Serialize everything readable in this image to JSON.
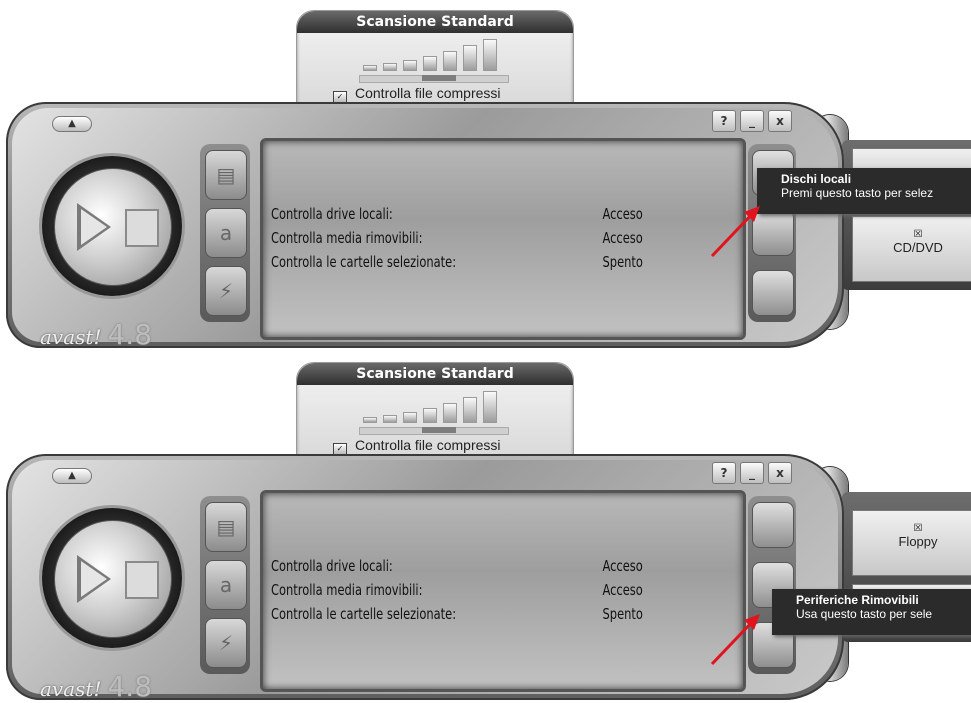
{
  "panels": [
    {
      "scan_title": "Scansione Standard",
      "scan_option": "Controlla file compressi",
      "status_rows": [
        {
          "label": "Controlla drive locali:",
          "value": "Acceso"
        },
        {
          "label": "Controlla media rimovibili:",
          "value": "Acceso"
        },
        {
          "label": "Controlla le cartelle selezionate:",
          "value": "Spento"
        }
      ],
      "window_buttons": [
        "?",
        "_",
        "x"
      ],
      "logo": "avast!",
      "version": "4.8",
      "drawer_option": "CD/DVD",
      "tooltip_title": "Dischi locali",
      "tooltip_text": "Premi questo tasto per selez"
    },
    {
      "scan_title": "Scansione Standard",
      "scan_option": "Controlla file compressi",
      "status_rows": [
        {
          "label": "Controlla drive locali:",
          "value": "Acceso"
        },
        {
          "label": "Controlla media rimovibili:",
          "value": "Acceso"
        },
        {
          "label": "Controlla le cartelle selezionate:",
          "value": "Spento"
        }
      ],
      "window_buttons": [
        "?",
        "_",
        "x"
      ],
      "logo": "avast!",
      "version": "4.8",
      "drawer_option": "Floppy",
      "tooltip_title": "Periferiche Rimovibili",
      "tooltip_text": "Usa questo tasto per sele"
    }
  ],
  "colors": {
    "annotation_arrow": "#e0141e"
  }
}
